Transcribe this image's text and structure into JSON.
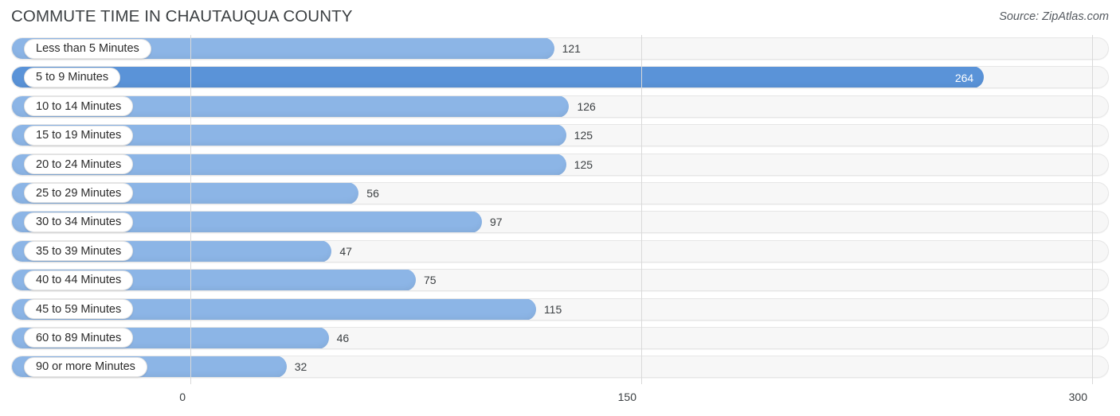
{
  "header": {
    "title": "COMMUTE TIME IN CHAUTAUQUA COUNTY",
    "source": "Source: ZipAtlas.com"
  },
  "colors": {
    "bar": "#8cb5e6",
    "bar_highlight": "#5a93d8",
    "track": "#f7f7f7",
    "gridline": "#d9d9d9",
    "text": "#3c4043"
  },
  "chart_data": {
    "type": "bar",
    "orientation": "horizontal",
    "title": "COMMUTE TIME IN CHAUTAUQUA COUNTY",
    "xlabel": "",
    "ylabel": "",
    "xlim": [
      0,
      300
    ],
    "xticks": [
      "0",
      "150",
      "300"
    ],
    "xtick_values": [
      0,
      150,
      300
    ],
    "grid": true,
    "legend": false,
    "categories": [
      "Less than 5 Minutes",
      "5 to 9 Minutes",
      "10 to 14 Minutes",
      "15 to 19 Minutes",
      "20 to 24 Minutes",
      "25 to 29 Minutes",
      "30 to 34 Minutes",
      "35 to 39 Minutes",
      "40 to 44 Minutes",
      "45 to 59 Minutes",
      "60 to 89 Minutes",
      "90 or more Minutes"
    ],
    "values": [
      121,
      264,
      126,
      125,
      125,
      56,
      97,
      47,
      75,
      115,
      46,
      32
    ],
    "value_labels": [
      "121",
      "264",
      "126",
      "125",
      "125",
      "56",
      "97",
      "47",
      "75",
      "115",
      "46",
      "32"
    ],
    "highlight_index": 1
  }
}
